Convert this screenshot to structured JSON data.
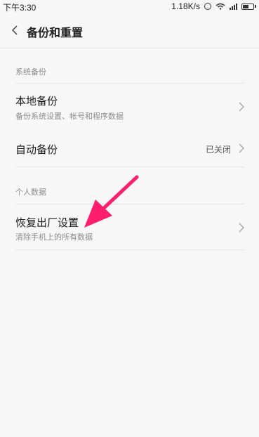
{
  "status_bar": {
    "time": "下午3:30",
    "speed": "1.18K/s"
  },
  "header": {
    "title": "备份和重置",
    "back_icon": "chevron-left-icon"
  },
  "sections": [
    {
      "label": "系统备份",
      "items": [
        {
          "title": "本地备份",
          "subtitle": "备份系统设置、帐号和程序数据"
        },
        {
          "title": "自动备份",
          "value": "已关闭"
        }
      ]
    },
    {
      "label": "个人数据",
      "items": [
        {
          "title": "恢复出厂设置",
          "subtitle": "清除手机上的所有数据"
        }
      ]
    }
  ],
  "colors": {
    "background": "#f7f7f7",
    "divider": "#e4e4e4",
    "secondary_text": "#8c8c8c",
    "annotation_arrow": "#ff1e6e"
  }
}
